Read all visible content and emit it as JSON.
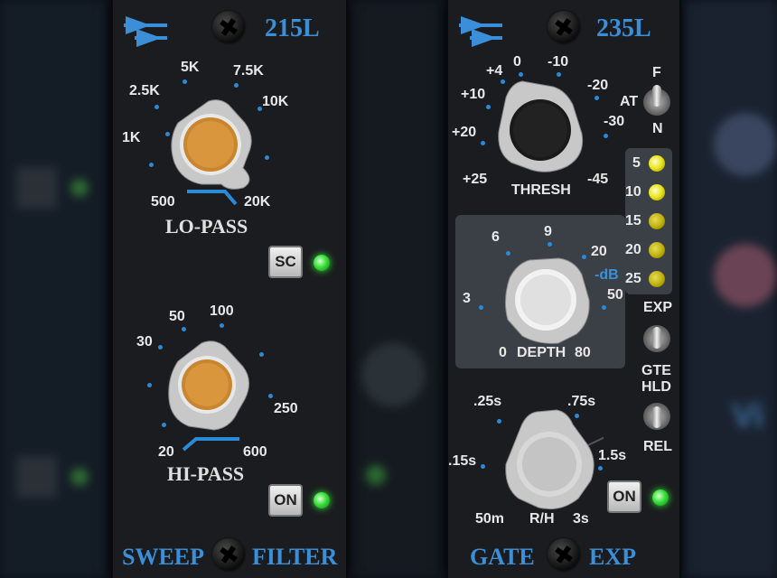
{
  "filter": {
    "model": "215L",
    "lopass": {
      "label": "LO-PASS",
      "ticks": [
        "1K",
        "2.5K",
        "5K",
        "7.5K",
        "10K",
        "500",
        "20K"
      ]
    },
    "hipass": {
      "label": "HI-PASS",
      "ticks": [
        "30",
        "50",
        "100",
        "250",
        "20",
        "600"
      ]
    },
    "sc_label": "SC",
    "on_label": "ON",
    "footer_left": "SWEEP",
    "footer_right": "FILTER"
  },
  "gate": {
    "model": "235L",
    "thresh": {
      "label": "THRESH",
      "ticks": [
        "+4",
        "0",
        "-10",
        "+10",
        "-20",
        "+20",
        "-30",
        "+25",
        "-45"
      ]
    },
    "depth": {
      "label": "DEPTH",
      "ticks": [
        "6",
        "9",
        "20",
        "-dB",
        "3",
        "50",
        "0",
        "80"
      ]
    },
    "rh": {
      "label": "R/H",
      "ticks": [
        ".25s",
        ".75s",
        ".15s",
        "1.5s",
        "50m",
        "3s"
      ]
    },
    "switch_fatn": {
      "top": "F",
      "mid": "AT",
      "bottom": "N"
    },
    "switch_mode": {
      "top": "EXP",
      "bottom": "GTE"
    },
    "switch_hold": {
      "top": "HLD",
      "bottom": "REL"
    },
    "meter": [
      "5",
      "10",
      "15",
      "20",
      "25"
    ],
    "on_label": "ON",
    "footer_left": "GATE",
    "footer_right": "EXP"
  },
  "colors": {
    "accent": "#3a8fd8",
    "led_green": "#39e03a",
    "led_yellow": "#e9e413"
  }
}
